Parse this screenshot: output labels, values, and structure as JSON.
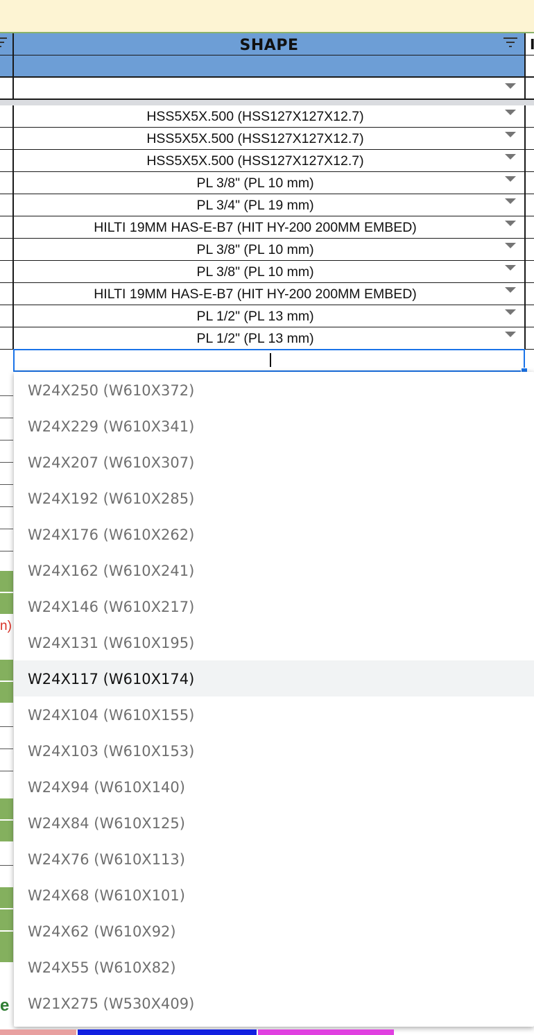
{
  "header": {
    "column_title": "SHAPE",
    "right_col_partial": "I"
  },
  "rows": [
    {
      "value": "HSS5X5X.500 (HSS127X127X12.7)"
    },
    {
      "value": "HSS5X5X.500 (HSS127X127X12.7)"
    },
    {
      "value": "HSS5X5X.500 (HSS127X127X12.7)"
    },
    {
      "value": "PL 3/8\" (PL 10 mm)"
    },
    {
      "value": "PL 3/4\" (PL 19 mm)"
    },
    {
      "value": "HILTI 19MM HAS-E-B7 (HIT HY-200 200MM EMBED)"
    },
    {
      "value": "PL 3/8\" (PL 10 mm)"
    },
    {
      "value": "PL 3/8\" (PL 10 mm)"
    },
    {
      "value": "HILTI 19MM HAS-E-B7 (HIT HY-200 200MM EMBED)"
    },
    {
      "value": "PL 1/2\" (PL 13 mm)"
    },
    {
      "value": "PL 1/2\" (PL 13 mm)"
    }
  ],
  "active_cell": {
    "value": ""
  },
  "dropdown": {
    "highlighted_index": 8,
    "options": [
      "W24X250 (W610X372)",
      "W24X229 (W610X341)",
      "W24X207 (W610X307)",
      "W24X192 (W610X285)",
      "W24X176 (W610X262)",
      "W24X162 (W610X241)",
      "W24X146 (W610X217)",
      "W24X131 (W610X195)",
      "W24X117 (W610X174)",
      "W24X104 (W610X155)",
      "W24X103 (W610X153)",
      "W24X94 (W610X140)",
      "W24X84 (W610X125)",
      "W24X76 (W610X113)",
      "W24X68 (W610X101)",
      "W24X62 (W610X92)",
      "W24X55 (W610X82)",
      "W21X275 (W530X409)"
    ]
  },
  "background_fragments": {
    "red_text": "n)",
    "green_text": "e"
  },
  "colors": {
    "header_blue": "#6d9ed6",
    "active_border": "#1a73e8",
    "banner": "#fdf4d3",
    "green_cell": "#84b05e"
  }
}
